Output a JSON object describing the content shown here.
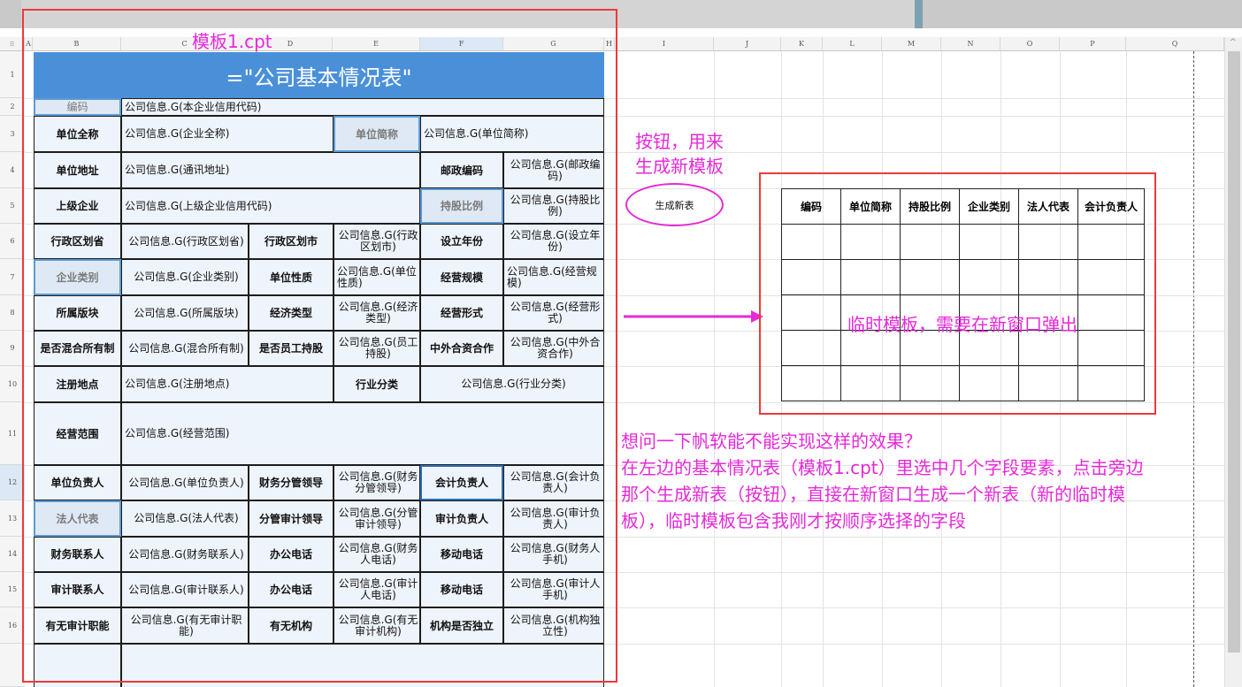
{
  "template_label": "模板1.cpt",
  "title_formula": "=\"公司基本情况表\"",
  "columns": [
    "A",
    "B",
    "C",
    "D",
    "E",
    "F",
    "G",
    "H",
    "I",
    "J",
    "K",
    "L",
    "M",
    "N",
    "O",
    "P",
    "Q"
  ],
  "rows": [
    "1",
    "2",
    "3",
    "4",
    "5",
    "6",
    "7",
    "8",
    "9",
    "10",
    "11",
    "12",
    "13",
    "14",
    "15",
    "16"
  ],
  "form": {
    "r2": {
      "l1": "编码",
      "v1": "公司信息.G(本企业信用代码)"
    },
    "r3": {
      "l1": "单位全称",
      "v1": "公司信息.G(企业全称)",
      "l2": "单位简称",
      "v2": "公司信息.G(单位简称)"
    },
    "r4": {
      "l1": "单位地址",
      "v1": "公司信息.G(通讯地址)",
      "l2": "邮政编码",
      "v2": "公司信息.G(邮政编码)"
    },
    "r5": {
      "l1": "上级企业",
      "v1": "公司信息.G(上级企业信用代码)",
      "l2": "持股比例",
      "v2": "公司信息.G(持股比例)"
    },
    "r6": {
      "l1": "行政区划省",
      "v1": "公司信息.G(行政区划省)",
      "l2": "行政区划市",
      "v2": "公司信息.G(行政区划市)",
      "l3": "设立年份",
      "v3": "公司信息.G(设立年份)"
    },
    "r7": {
      "l1": "企业类别",
      "v1": "公司信息.G(企业类别)",
      "l2": "单位性质",
      "v2": "公司信息.G(单位性质)",
      "l3": "经营规模",
      "v3": "公司信息.G(经营规模)"
    },
    "r8": {
      "l1": "所属版块",
      "v1": "公司信息.G(所属版块)",
      "l2": "经济类型",
      "v2": "公司信息.G(经济类型)",
      "l3": "经营形式",
      "v3": "公司信息.G(经营形式)"
    },
    "r9": {
      "l1": "是否混合所有制",
      "v1": "公司信息.G(混合所有制)",
      "l2": "是否员工持股",
      "v2": "公司信息.G(员工持股)",
      "l3": "中外合资合作",
      "v3": "公司信息.G(中外合资合作)"
    },
    "r10": {
      "l1": "注册地点",
      "v1": "公司信息.G(注册地点)",
      "l2": "行业分类",
      "v2": "公司信息.G(行业分类)"
    },
    "r11": {
      "l1": "经营范围",
      "v1": "公司信息.G(经营范围)"
    },
    "r12": {
      "l1": "单位负责人",
      "v1": "公司信息.G(单位负责人)",
      "l2": "财务分管领导",
      "v2": "公司信息.G(财务分管领导)",
      "l3": "会计负责人",
      "v3": "公司信息.G(会计负责人)"
    },
    "r13": {
      "l1": "法人代表",
      "v1": "公司信息.G(法人代表)",
      "l2": "分管审计领导",
      "v2": "公司信息.G(分管审计领导)",
      "l3": "审计负责人",
      "v3": "公司信息.G(审计负责人)"
    },
    "r14": {
      "l1": "财务联系人",
      "v1": "公司信息.G(财务联系人)",
      "l2": "办公电话",
      "v2": "公司信息.G(财务人电话)",
      "l3": "移动电话",
      "v3": "公司信息.G(财务人手机)"
    },
    "r15": {
      "l1": "审计联系人",
      "v1": "公司信息.G(审计联系人)",
      "l2": "办公电话",
      "v2": "公司信息.G(审计人电话)",
      "l3": "移动电话",
      "v3": "公司信息.G(审计人手机)"
    },
    "r16": {
      "l1": "有无审计职能",
      "v1": "公司信息.G(有无审计职能)",
      "l2": "有无机构",
      "v2": "公司信息.G(有无审计机构)",
      "l3": "机构是否独立",
      "v3": "公司信息.G(机构独立性)"
    }
  },
  "annotations": {
    "button_note_1": "按钮，用来",
    "button_note_2": "生成新模板",
    "button_label": "生成新表",
    "temp_note": "临时模板，需要在新窗口弹出",
    "question_1": "想问一下帆软能不能实现这样的效果？",
    "question_2": "在左边的基本情况表（模板1.cpt）里选中几个字段要素，点击旁边",
    "question_3": "那个生成新表（按钮），直接在新窗口生成一个新表（新的临时模",
    "question_4": "板），临时模板包含我刚才按顺序选择的字段"
  },
  "new_table_headers": [
    "编码",
    "单位简称",
    "持股比例",
    "企业类别",
    "法人代表",
    "会计负责人"
  ],
  "colors": {
    "title_bg": "#4a90d9",
    "annotation": "#e52ad8",
    "red_box": "#ea3b3b",
    "selection": "#5b9bd5"
  }
}
